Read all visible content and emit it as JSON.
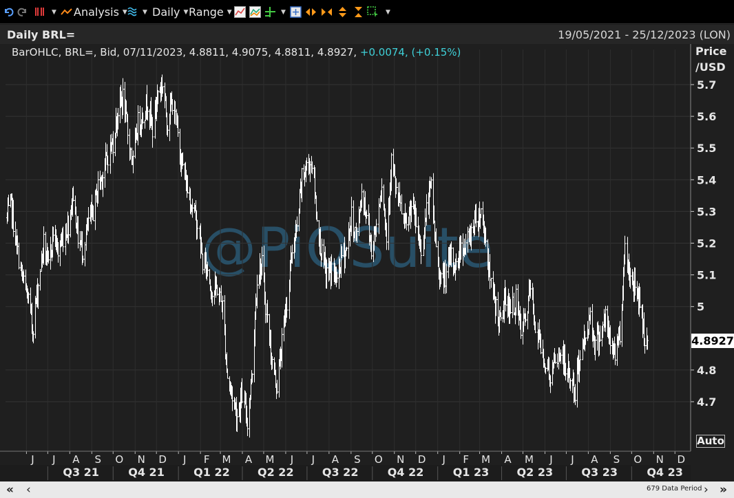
{
  "toolbar": {
    "analysis_label": "Analysis",
    "interval_label": "Daily",
    "range_label": "Range"
  },
  "chart_header": {
    "title": "Daily BRL=",
    "date_range": "19/05/2021 - 25/12/2023 (LON)"
  },
  "info_line": {
    "prefix": "BarOHLC, BRL=, Bid, 07/11/2023, 4.8811, 4.9075, 4.8811, 4.8927,",
    "change": "+0.0074, (+0.15%)"
  },
  "axis": {
    "unit_line1": "Price",
    "unit_line2": "/USD",
    "auto_label": "Auto",
    "last_price_label": "4.8927"
  },
  "watermark": "@PiQSuite",
  "footer": {
    "scroll_left_fast": "«",
    "scroll_left": "‹",
    "data_period": "679 Data Period",
    "scroll_right": "›",
    "scroll_right_fast": "»"
  },
  "colors": {
    "background": "#1f1f1f",
    "bars": "#ffffff",
    "grid": "#333333",
    "change_positive": "#3fd0d8",
    "watermark": "#3076a0"
  },
  "chart_data": {
    "type": "bar",
    "subtype": "ohlc",
    "title": "Daily BRL=",
    "ylabel": "Price /USD",
    "ylim": [
      4.61,
      5.83
    ],
    "y_ticks": [
      "5.7",
      "5.6",
      "5.5",
      "5.4",
      "5.3",
      "5.2",
      "5.1",
      "5",
      "4.8",
      "4.7"
    ],
    "month_labels": [
      "J",
      "J",
      "A",
      "S",
      "O",
      "N",
      "D",
      "J",
      "F",
      "M",
      "A",
      "M",
      "J",
      "J",
      "A",
      "S",
      "O",
      "N",
      "D",
      "J",
      "F",
      "M",
      "A",
      "M",
      "J",
      "J",
      "A",
      "S",
      "O",
      "N",
      "D"
    ],
    "quarter_labels": [
      "Q3 21",
      "Q4 21",
      "Q1 22",
      "Q2 22",
      "Q3 22",
      "Q4 22",
      "Q1 23",
      "Q2 23",
      "Q3 23",
      "Q4 23"
    ],
    "grid": true,
    "last_value": 4.8927,
    "approx_close_series": [
      [
        "2021-05-19",
        5.28
      ],
      [
        "2021-05-25",
        5.32
      ],
      [
        "2021-06-02",
        5.18
      ],
      [
        "2021-06-10",
        5.08
      ],
      [
        "2021-06-18",
        5.02
      ],
      [
        "2021-06-24",
        4.93
      ],
      [
        "2021-07-02",
        5.07
      ],
      [
        "2021-07-09",
        5.2
      ],
      [
        "2021-07-16",
        5.12
      ],
      [
        "2021-07-23",
        5.24
      ],
      [
        "2021-07-30",
        5.17
      ],
      [
        "2021-08-06",
        5.22
      ],
      [
        "2021-08-13",
        5.26
      ],
      [
        "2021-08-20",
        5.36
      ],
      [
        "2021-08-27",
        5.22
      ],
      [
        "2021-09-03",
        5.18
      ],
      [
        "2021-09-10",
        5.26
      ],
      [
        "2021-09-17",
        5.3
      ],
      [
        "2021-09-24",
        5.38
      ],
      [
        "2021-10-01",
        5.42
      ],
      [
        "2021-10-08",
        5.48
      ],
      [
        "2021-10-15",
        5.52
      ],
      [
        "2021-10-22",
        5.62
      ],
      [
        "2021-10-29",
        5.66
      ],
      [
        "2021-11-05",
        5.55
      ],
      [
        "2021-11-12",
        5.45
      ],
      [
        "2021-11-19",
        5.58
      ],
      [
        "2021-11-26",
        5.6
      ],
      [
        "2021-12-03",
        5.65
      ],
      [
        "2021-12-10",
        5.56
      ],
      [
        "2021-12-17",
        5.68
      ],
      [
        "2021-12-24",
        5.7
      ],
      [
        "2021-12-31",
        5.58
      ],
      [
        "2022-01-07",
        5.65
      ],
      [
        "2022-01-14",
        5.54
      ],
      [
        "2022-01-21",
        5.44
      ],
      [
        "2022-01-28",
        5.37
      ],
      [
        "2022-02-04",
        5.32
      ],
      [
        "2022-02-11",
        5.26
      ],
      [
        "2022-02-18",
        5.14
      ],
      [
        "2022-02-25",
        5.12
      ],
      [
        "2022-03-04",
        5.04
      ],
      [
        "2022-03-11",
        5.06
      ],
      [
        "2022-03-18",
        5.0
      ],
      [
        "2022-03-25",
        4.78
      ],
      [
        "2022-04-01",
        4.72
      ],
      [
        "2022-04-08",
        4.66
      ],
      [
        "2022-04-15",
        4.72
      ],
      [
        "2022-04-22",
        4.64
      ],
      [
        "2022-04-29",
        4.8
      ],
      [
        "2022-05-06",
        5.1
      ],
      [
        "2022-05-13",
        5.13
      ],
      [
        "2022-05-20",
        4.96
      ],
      [
        "2022-05-27",
        4.82
      ],
      [
        "2022-06-03",
        4.75
      ],
      [
        "2022-06-10",
        4.88
      ],
      [
        "2022-06-17",
        5.02
      ],
      [
        "2022-06-24",
        5.18
      ],
      [
        "2022-07-01",
        5.24
      ],
      [
        "2022-07-08",
        5.4
      ],
      [
        "2022-07-15",
        5.44
      ],
      [
        "2022-07-22",
        5.46
      ],
      [
        "2022-07-29",
        5.28
      ],
      [
        "2022-08-05",
        5.16
      ],
      [
        "2022-08-12",
        5.1
      ],
      [
        "2022-08-19",
        5.12
      ],
      [
        "2022-08-26",
        5.08
      ],
      [
        "2022-09-02",
        5.16
      ],
      [
        "2022-09-09",
        5.18
      ],
      [
        "2022-09-16",
        5.28
      ],
      [
        "2022-09-23",
        5.22
      ],
      [
        "2022-09-30",
        5.36
      ],
      [
        "2022-10-07",
        5.3
      ],
      [
        "2022-10-14",
        5.18
      ],
      [
        "2022-10-21",
        5.26
      ],
      [
        "2022-10-28",
        5.4
      ],
      [
        "2022-11-04",
        5.22
      ],
      [
        "2022-11-11",
        5.46
      ],
      [
        "2022-11-18",
        5.36
      ],
      [
        "2022-11-25",
        5.3
      ],
      [
        "2022-12-02",
        5.24
      ],
      [
        "2022-12-09",
        5.32
      ],
      [
        "2022-12-16",
        5.26
      ],
      [
        "2022-12-23",
        5.18
      ],
      [
        "2022-12-30",
        5.3
      ],
      [
        "2023-01-06",
        5.38
      ],
      [
        "2023-01-13",
        5.18
      ],
      [
        "2023-01-20",
        5.08
      ],
      [
        "2023-01-27",
        5.1
      ],
      [
        "2023-02-03",
        5.16
      ],
      [
        "2023-02-10",
        5.12
      ],
      [
        "2023-02-17",
        5.2
      ],
      [
        "2023-02-24",
        5.18
      ],
      [
        "2023-03-03",
        5.24
      ],
      [
        "2023-03-10",
        5.28
      ],
      [
        "2023-03-17",
        5.3
      ],
      [
        "2023-03-24",
        5.22
      ],
      [
        "2023-03-31",
        5.06
      ],
      [
        "2023-04-07",
        5.0
      ],
      [
        "2023-04-14",
        4.94
      ],
      [
        "2023-04-21",
        5.04
      ],
      [
        "2023-04-28",
        4.98
      ],
      [
        "2023-05-05",
        5.02
      ],
      [
        "2023-05-12",
        4.92
      ],
      [
        "2023-05-19",
        4.96
      ],
      [
        "2023-05-26",
        5.06
      ],
      [
        "2023-06-02",
        4.94
      ],
      [
        "2023-06-09",
        4.88
      ],
      [
        "2023-06-16",
        4.82
      ],
      [
        "2023-06-23",
        4.78
      ],
      [
        "2023-06-30",
        4.82
      ],
      [
        "2023-07-07",
        4.86
      ],
      [
        "2023-07-14",
        4.8
      ],
      [
        "2023-07-21",
        4.78
      ],
      [
        "2023-07-28",
        4.72
      ],
      [
        "2023-08-04",
        4.86
      ],
      [
        "2023-08-11",
        4.9
      ],
      [
        "2023-08-18",
        4.98
      ],
      [
        "2023-08-25",
        4.88
      ],
      [
        "2023-09-01",
        4.92
      ],
      [
        "2023-09-08",
        4.96
      ],
      [
        "2023-09-15",
        4.88
      ],
      [
        "2023-09-22",
        4.86
      ],
      [
        "2023-09-29",
        4.92
      ],
      [
        "2023-10-06",
        5.18
      ],
      [
        "2023-10-13",
        5.1
      ],
      [
        "2023-10-20",
        5.06
      ],
      [
        "2023-10-27",
        5.02
      ],
      [
        "2023-11-03",
        4.9
      ],
      [
        "2023-11-07",
        4.8927
      ]
    ]
  }
}
